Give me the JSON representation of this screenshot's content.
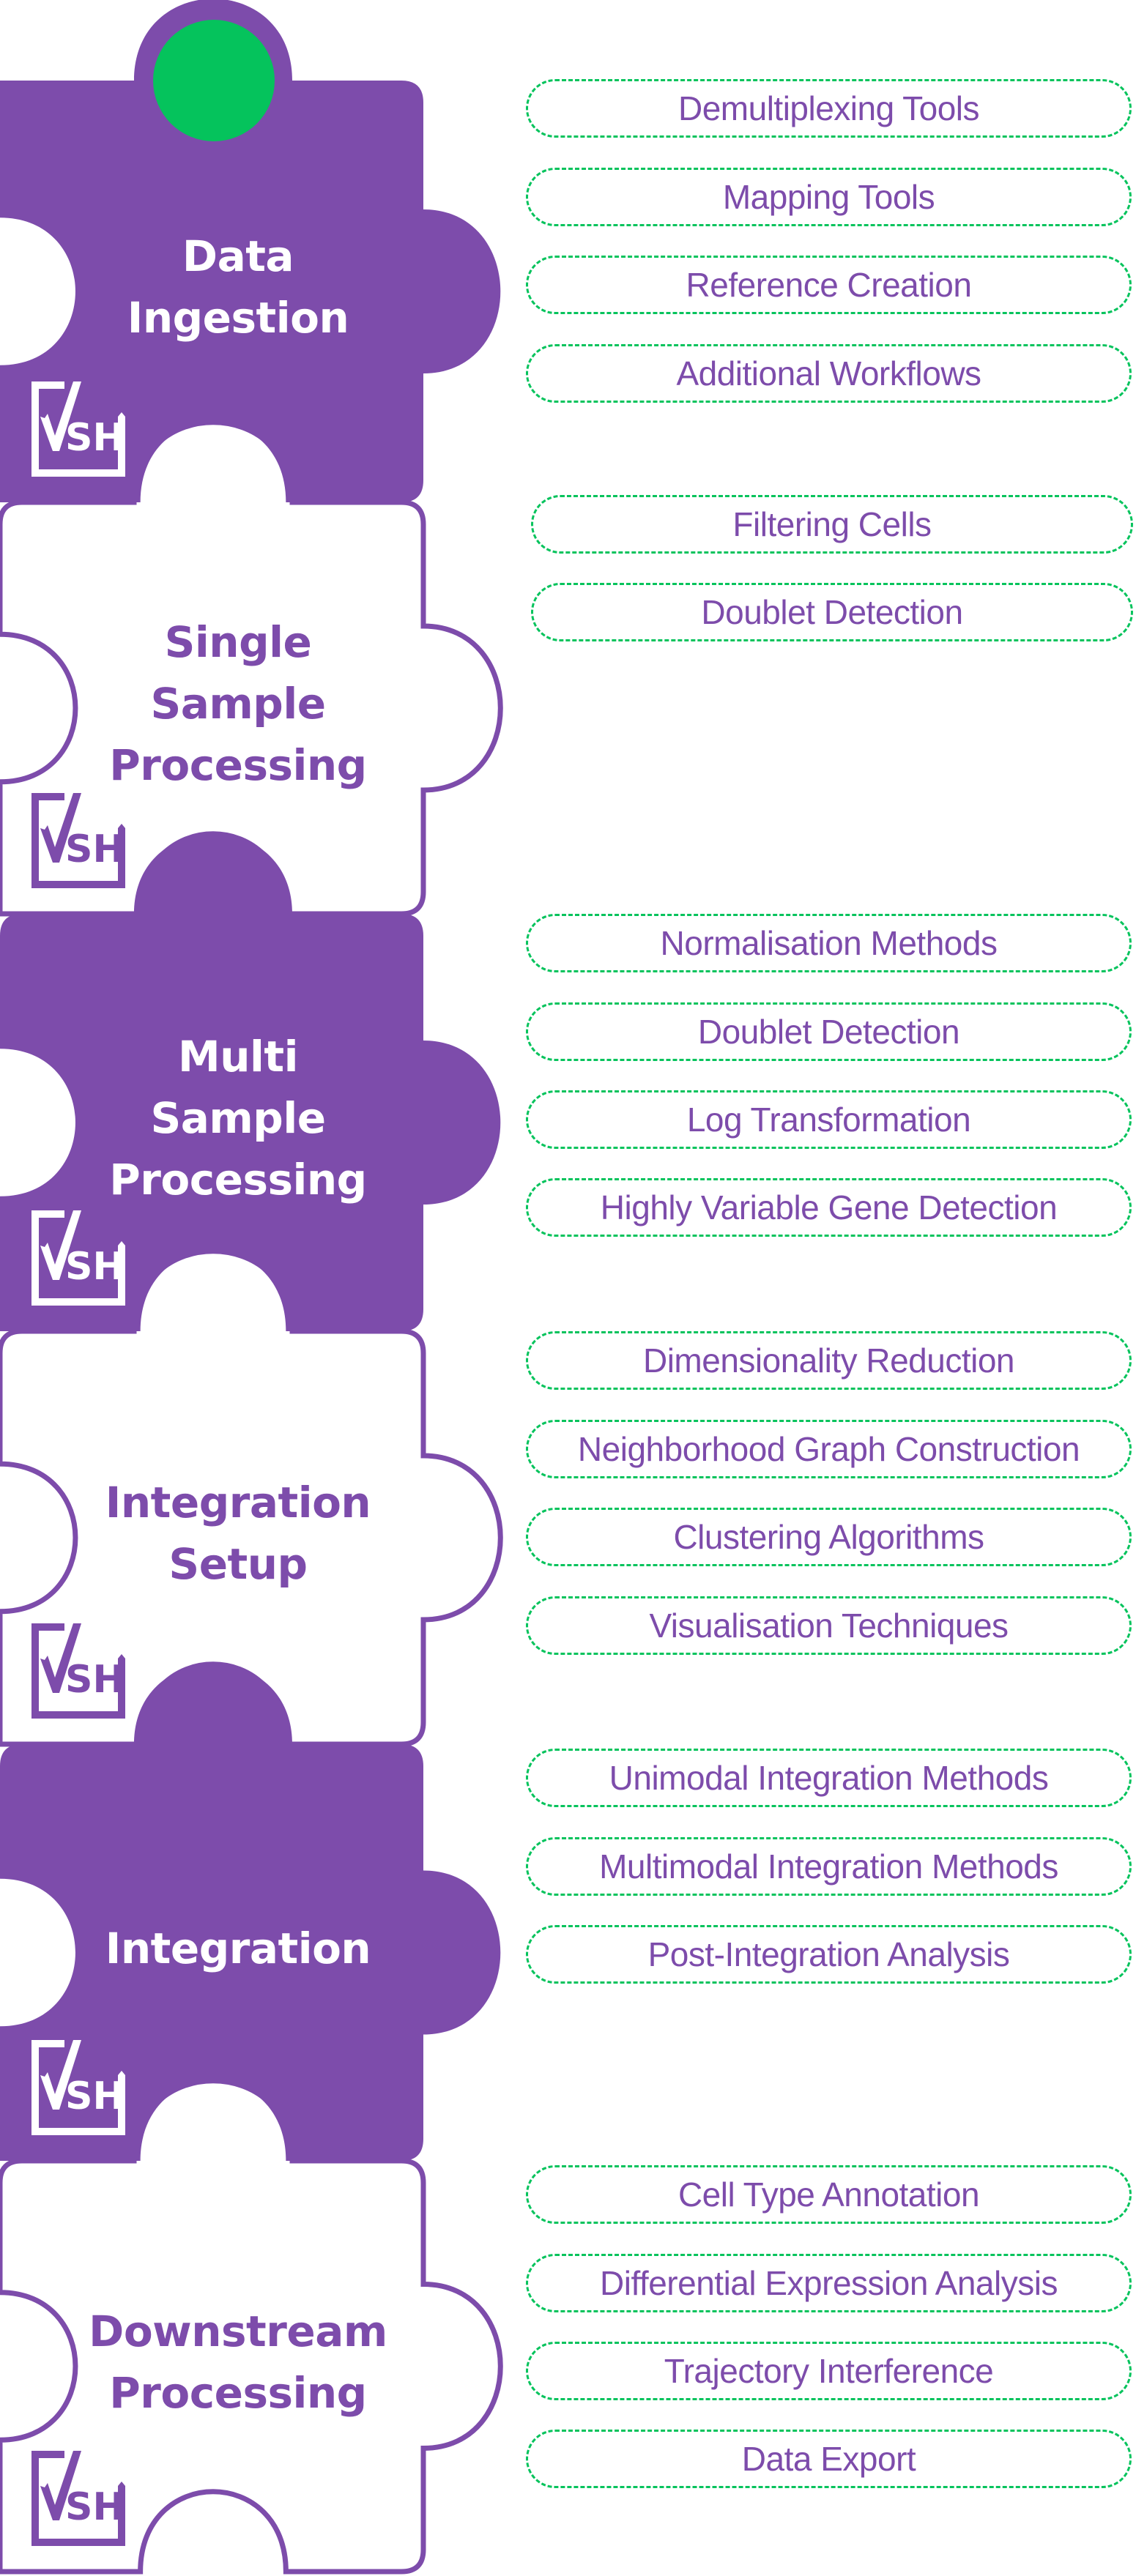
{
  "colors": {
    "purple": "#7d4cab",
    "green": "#05c35c",
    "white": "#ffffff"
  },
  "logo_text": "VSH",
  "status_dot": "green-circle",
  "stages": [
    {
      "title_lines": [
        "Data",
        "Ingestion"
      ],
      "style": "filled",
      "items": [
        "Demultiplexing Tools",
        "Mapping Tools",
        "Reference Creation",
        "Additional Workflows"
      ]
    },
    {
      "title_lines": [
        "Single",
        "Sample",
        "Processing"
      ],
      "style": "outline",
      "items": [
        "Filtering Cells",
        "Doublet Detection"
      ]
    },
    {
      "title_lines": [
        "Multi",
        "Sample",
        "Processing"
      ],
      "style": "filled",
      "items": [
        "Normalisation Methods",
        "Doublet Detection",
        "Log Transformation",
        "Highly Variable Gene Detection"
      ]
    },
    {
      "title_lines": [
        "Integration",
        "Setup"
      ],
      "style": "outline",
      "items": [
        "Dimensionality Reduction",
        "Neighborhood Graph Construction",
        "Clustering Algorithms",
        "Visualisation Techniques"
      ]
    },
    {
      "title_lines": [
        "Integration"
      ],
      "style": "filled",
      "items": [
        "Unimodal Integration Methods",
        "Multimodal Integration Methods",
        "Post-Integration Analysis"
      ]
    },
    {
      "title_lines": [
        "Downstream",
        "Processing"
      ],
      "style": "outline",
      "items": [
        "Cell Type Annotation",
        "Differential Expression Analysis",
        "Trajectory Interference",
        "Data Export"
      ]
    }
  ]
}
